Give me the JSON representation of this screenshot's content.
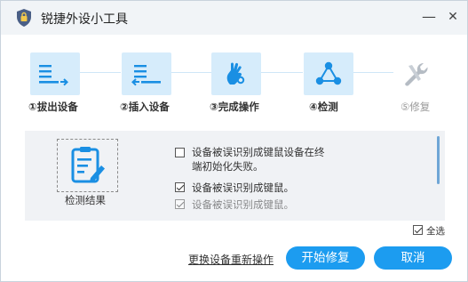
{
  "window": {
    "title": "锐捷外设小工具",
    "minimize_glyph": "—",
    "close_glyph": "✕",
    "app_icon": "shield-lock-icon"
  },
  "steps": [
    {
      "label": "①拔出设备",
      "icon": "unplug-icon",
      "state": "done"
    },
    {
      "label": "②插入设备",
      "icon": "plug-in-icon",
      "state": "done"
    },
    {
      "label": "③完成操作",
      "icon": "hand-gesture-icon",
      "state": "done"
    },
    {
      "label": "④检测",
      "icon": "network-nodes-icon",
      "state": "current"
    },
    {
      "label": "⑤修复",
      "icon": "wrench-icon",
      "state": "pending"
    }
  ],
  "result": {
    "label": "检测结果",
    "icon": "clipboard-edit-icon",
    "items": [
      {
        "text_line1": "设备被误识别成键鼠设备在终",
        "text_line2": "端初始化失败。",
        "checked": false
      },
      {
        "text": "设备被误识别成键鼠。",
        "checked": true
      },
      {
        "text": "设备被误识别成键鼠。",
        "checked": true
      }
    ]
  },
  "select_all": {
    "label": "全选",
    "checked": true
  },
  "actions": {
    "replace_link": "更换设备重新操作",
    "start_repair": "开始修复",
    "cancel": "取消"
  },
  "colors": {
    "accent": "#1c9cf0",
    "step_bg": "#d6ecfb",
    "panel_bg": "#f0f2f5",
    "titlebar_bg": "#f1f4f7"
  }
}
